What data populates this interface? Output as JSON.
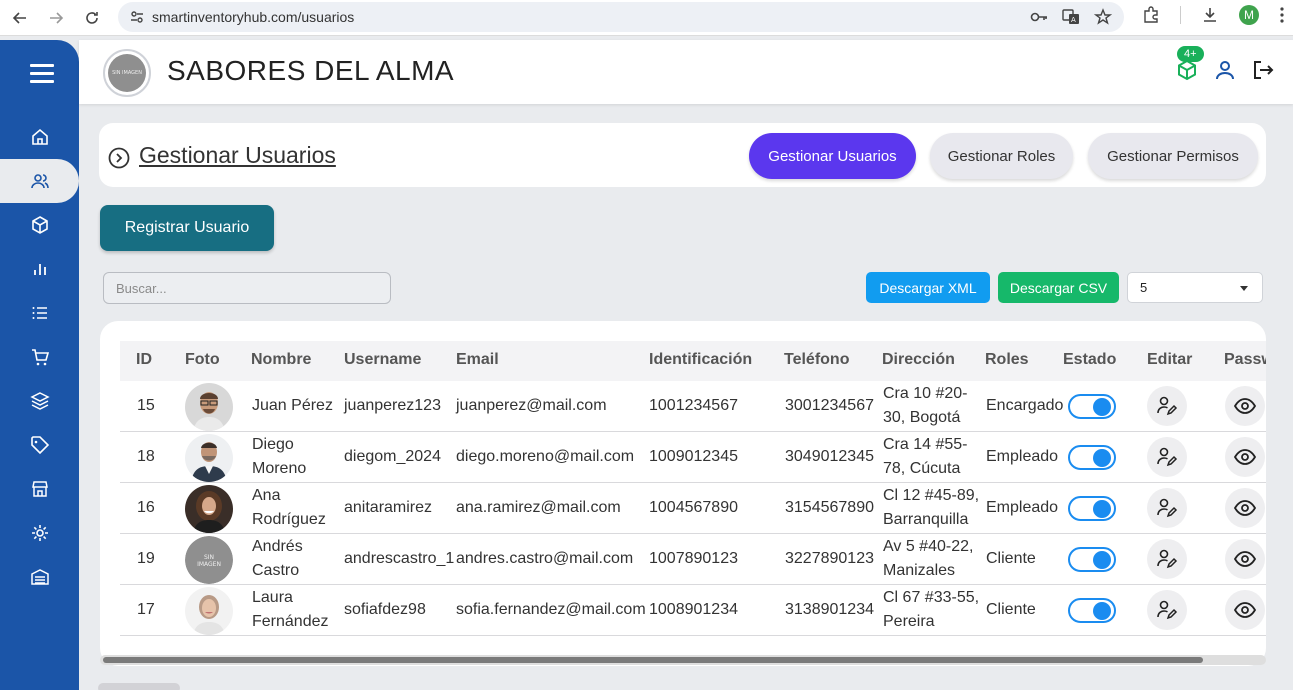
{
  "browser": {
    "url": "smartinventoryhub.com/usuarios",
    "profile_initial": "M"
  },
  "header": {
    "brand": "SABORES DEL ALMA",
    "logo_text": "SIN IMAGEN",
    "notification_badge": "4+"
  },
  "page": {
    "title": "Gestionar Usuarios",
    "tabs": [
      {
        "label": "Gestionar Usuarios",
        "active": true
      },
      {
        "label": "Gestionar Roles",
        "active": false
      },
      {
        "label": "Gestionar Permisos",
        "active": false
      }
    ],
    "register_button": "Registrar Usuario",
    "search_placeholder": "Buscar...",
    "download_xml": "Descargar XML",
    "download_csv": "Descargar CSV",
    "page_size": "5"
  },
  "colors": {
    "sidebar": "#1b55a8",
    "active_tab": "#5b37ee",
    "register": "#176e82",
    "xml": "#119cf0",
    "csv": "#16b86a",
    "toggle": "#1a8cf0"
  },
  "table": {
    "columns": [
      "ID",
      "Foto",
      "Nombre",
      "Username",
      "Email",
      "Identificación",
      "Teléfono",
      "Dirección",
      "Roles",
      "Estado",
      "Editar",
      "Passw"
    ],
    "rows": [
      {
        "id": "15",
        "name1": "Juan Pérez",
        "name2": "",
        "username": "juanperez123",
        "email": "juanperez@mail.com",
        "ident": "1001234567",
        "phone": "3001234567",
        "addr1": "Cra 10 #20-",
        "addr2": "30, Bogotá",
        "role": "Encargado",
        "active": true,
        "photo": "man-glasses"
      },
      {
        "id": "18",
        "name1": "Diego",
        "name2": "Moreno",
        "username": "diegom_2024",
        "email": "diego.moreno@mail.com",
        "ident": "1009012345",
        "phone": "3049012345",
        "addr1": "Cra 14 #55-",
        "addr2": "78, Cúcuta",
        "role": "Empleado",
        "active": true,
        "photo": "man-suit"
      },
      {
        "id": "16",
        "name1": "Ana",
        "name2": "Rodríguez",
        "username": "anitaramirez",
        "email": "ana.ramirez@mail.com",
        "ident": "1004567890",
        "phone": "3154567890",
        "addr1": "Cl 12 #45-89,",
        "addr2": "Barranquilla",
        "role": "Empleado",
        "active": true,
        "photo": "woman-curly"
      },
      {
        "id": "19",
        "name1": "Andrés",
        "name2": "Castro",
        "username": "andrescastro_1",
        "email": "andres.castro@mail.com",
        "ident": "1007890123",
        "phone": "3227890123",
        "addr1": "Av 5 #40-22,",
        "addr2": "Manizales",
        "role": "Cliente",
        "active": true,
        "photo": "no-image"
      },
      {
        "id": "17",
        "name1": "Laura",
        "name2": "Fernández",
        "username": "sofiafdez98",
        "email": "sofia.fernandez@mail.com",
        "ident": "1008901234",
        "phone": "3138901234",
        "addr1": "Cl 67 #33-55,",
        "addr2": "Pereira",
        "role": "Cliente",
        "active": true,
        "photo": "woman-light"
      }
    ]
  }
}
